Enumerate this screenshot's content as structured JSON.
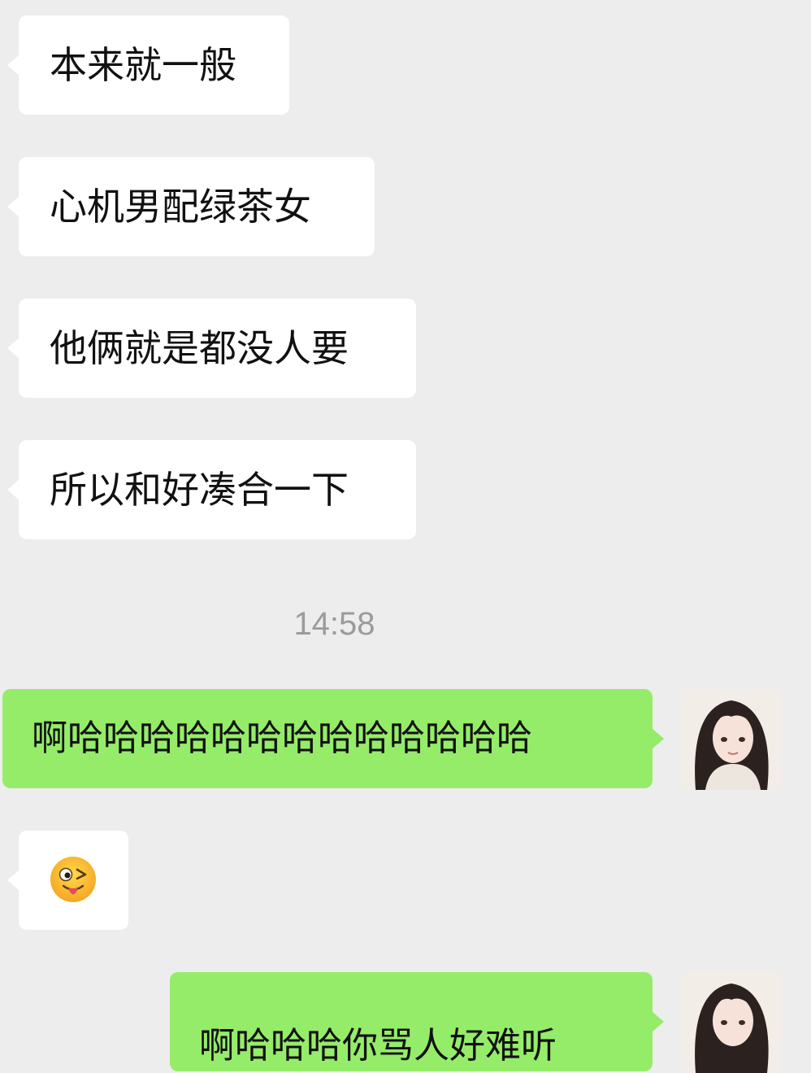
{
  "colors": {
    "background": "#ededed",
    "incoming_bubble": "#ffffff",
    "outgoing_bubble": "#95ec69",
    "text": "#111111",
    "timestamp": "#9b9b9b"
  },
  "messages": [
    {
      "side": "incoming",
      "text": "本来就一般"
    },
    {
      "side": "incoming",
      "text": "心机男配绿茶女"
    },
    {
      "side": "incoming",
      "text": "他俩就是都没人要"
    },
    {
      "side": "incoming",
      "text": "所以和好凑合一下"
    },
    {
      "side": "outgoing",
      "text": "啊哈哈哈哈哈哈哈哈哈哈哈哈哈"
    },
    {
      "side": "incoming",
      "emoji": "winking-face-with-tongue-icon"
    },
    {
      "side": "outgoing",
      "text": "啊哈哈哈你骂人好难听"
    }
  ],
  "timestamp": "14:58",
  "avatar": {
    "icon": "user-avatar-icon"
  }
}
